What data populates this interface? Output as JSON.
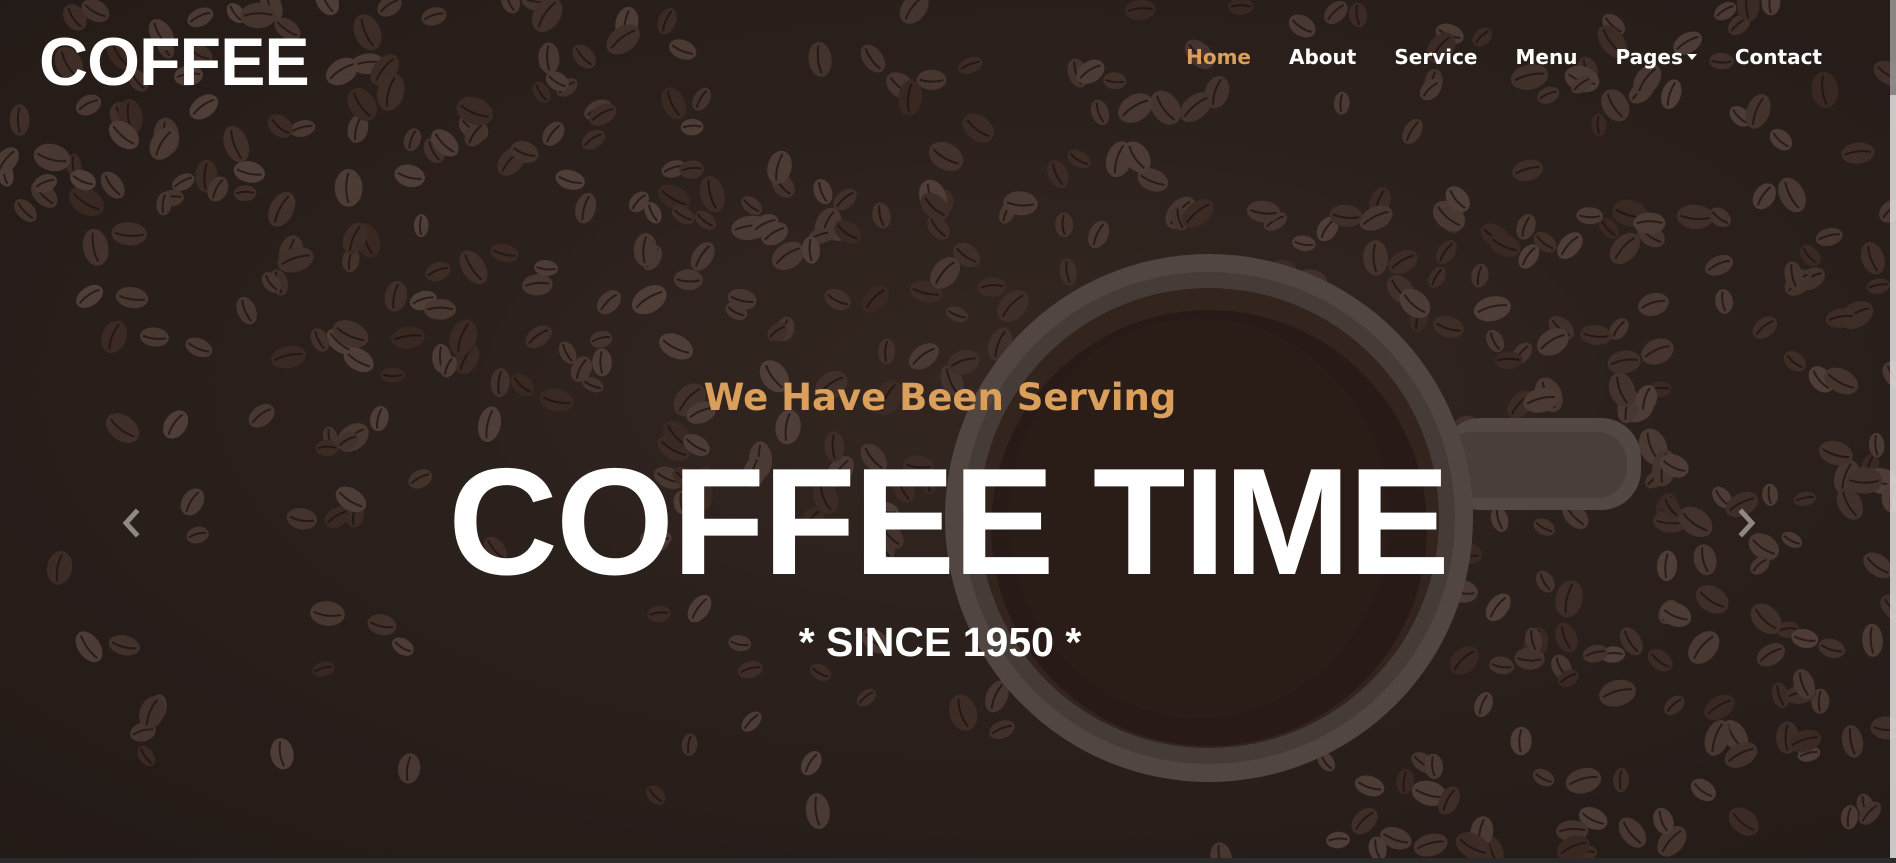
{
  "brand": {
    "name": "COFFEE"
  },
  "nav": {
    "items": [
      {
        "label": "Home",
        "active": true
      },
      {
        "label": "About"
      },
      {
        "label": "Service"
      },
      {
        "label": "Menu"
      },
      {
        "label": "Pages",
        "dropdown": true
      },
      {
        "label": "Contact"
      }
    ]
  },
  "hero": {
    "subtitle": "We Have Been Serving",
    "title": "COFFEE TIME",
    "tagline": "* SINCE 1950 *",
    "controls": {
      "prev_icon": "chevron-left-icon",
      "next_icon": "chevron-right-icon"
    }
  },
  "colors": {
    "accent": "#DA9F5B",
    "text": "#FFFFFF",
    "background": "#2F241F"
  }
}
